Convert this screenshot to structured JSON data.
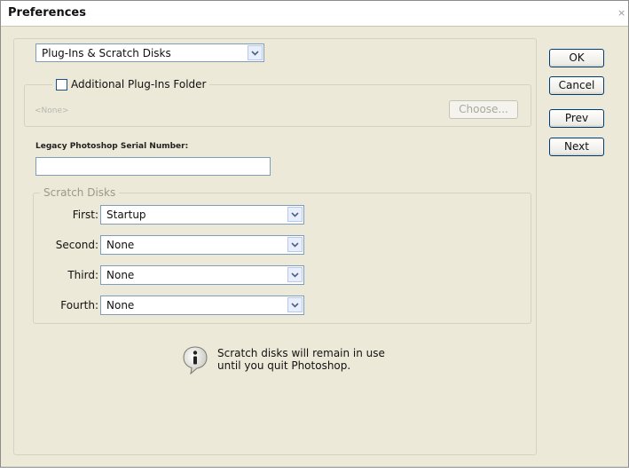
{
  "window": {
    "title": "Preferences",
    "close_glyph": "×"
  },
  "section_select": {
    "value": "Plug-Ins & Scratch Disks"
  },
  "plugins": {
    "checkbox_label": "Additional Plug-Ins Folder",
    "checked": false,
    "path": "<None>",
    "choose_label": "Choose..."
  },
  "serial": {
    "label": "Legacy Photoshop Serial Number:",
    "value": ""
  },
  "scratch": {
    "title": "Scratch Disks",
    "disks": [
      {
        "label": "First:",
        "value": "Startup"
      },
      {
        "label": "Second:",
        "value": "None"
      },
      {
        "label": "Third:",
        "value": "None"
      },
      {
        "label": "Fourth:",
        "value": "None"
      }
    ]
  },
  "info": {
    "line1": "Scratch disks will remain in use",
    "line2": "until you quit Photoshop."
  },
  "buttons": {
    "ok": "OK",
    "cancel": "Cancel",
    "prev": "Prev",
    "next": "Next"
  },
  "colors": {
    "dialog_bg": "#ece9d8",
    "input_border": "#7f9db9",
    "button_border": "#003c74"
  }
}
